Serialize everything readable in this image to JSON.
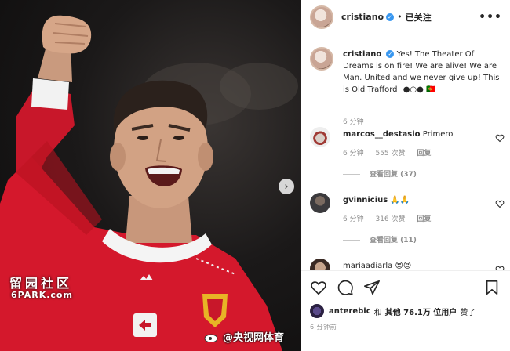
{
  "post": {
    "author": "cristiano",
    "follow_status": "已关注",
    "more": "•••",
    "caption": "Yes! The Theater Of Dreams is on fire! We are alive! We are Man. United and we never give up! This is Old Trafford! ●○● 🇵🇹",
    "caption_time": "6 分钟"
  },
  "photo": {
    "watermark": "留园社区",
    "watermark_sub": "6PARK.com",
    "sponsor": "TeamViewer",
    "next_arrow": "›"
  },
  "comments": [
    {
      "user": "marcos__destasio",
      "text": "Primero",
      "time": "6 分钟",
      "likes": "555 次赞",
      "reply": "回复",
      "view_replies": "查看回复 (37)"
    },
    {
      "user": "gvinnicius",
      "text": "🙏🙏",
      "time": "6 分钟",
      "likes": "316 次赞",
      "reply": "回复",
      "view_replies": "查看回复 (11)"
    },
    {
      "user": "mariaadiarla",
      "text": "😍😍",
      "time": "",
      "likes": "",
      "reply": "",
      "view_replies": ""
    }
  ],
  "likes": {
    "user": "anterebic",
    "and": "和",
    "others": "其他 76.1万 位用户",
    "suffix": "赞了"
  },
  "time_ago": "6 分钟前",
  "credit": "@央视网体育",
  "icons": [
    "heart-icon",
    "comment-icon",
    "share-icon",
    "bookmark-icon",
    "verified-icon",
    "more-icon"
  ],
  "colors": {
    "jersey_red": "#d4182c",
    "verified_blue": "#3897f0",
    "text_primary": "#262626",
    "text_secondary": "#8e8e8e"
  }
}
